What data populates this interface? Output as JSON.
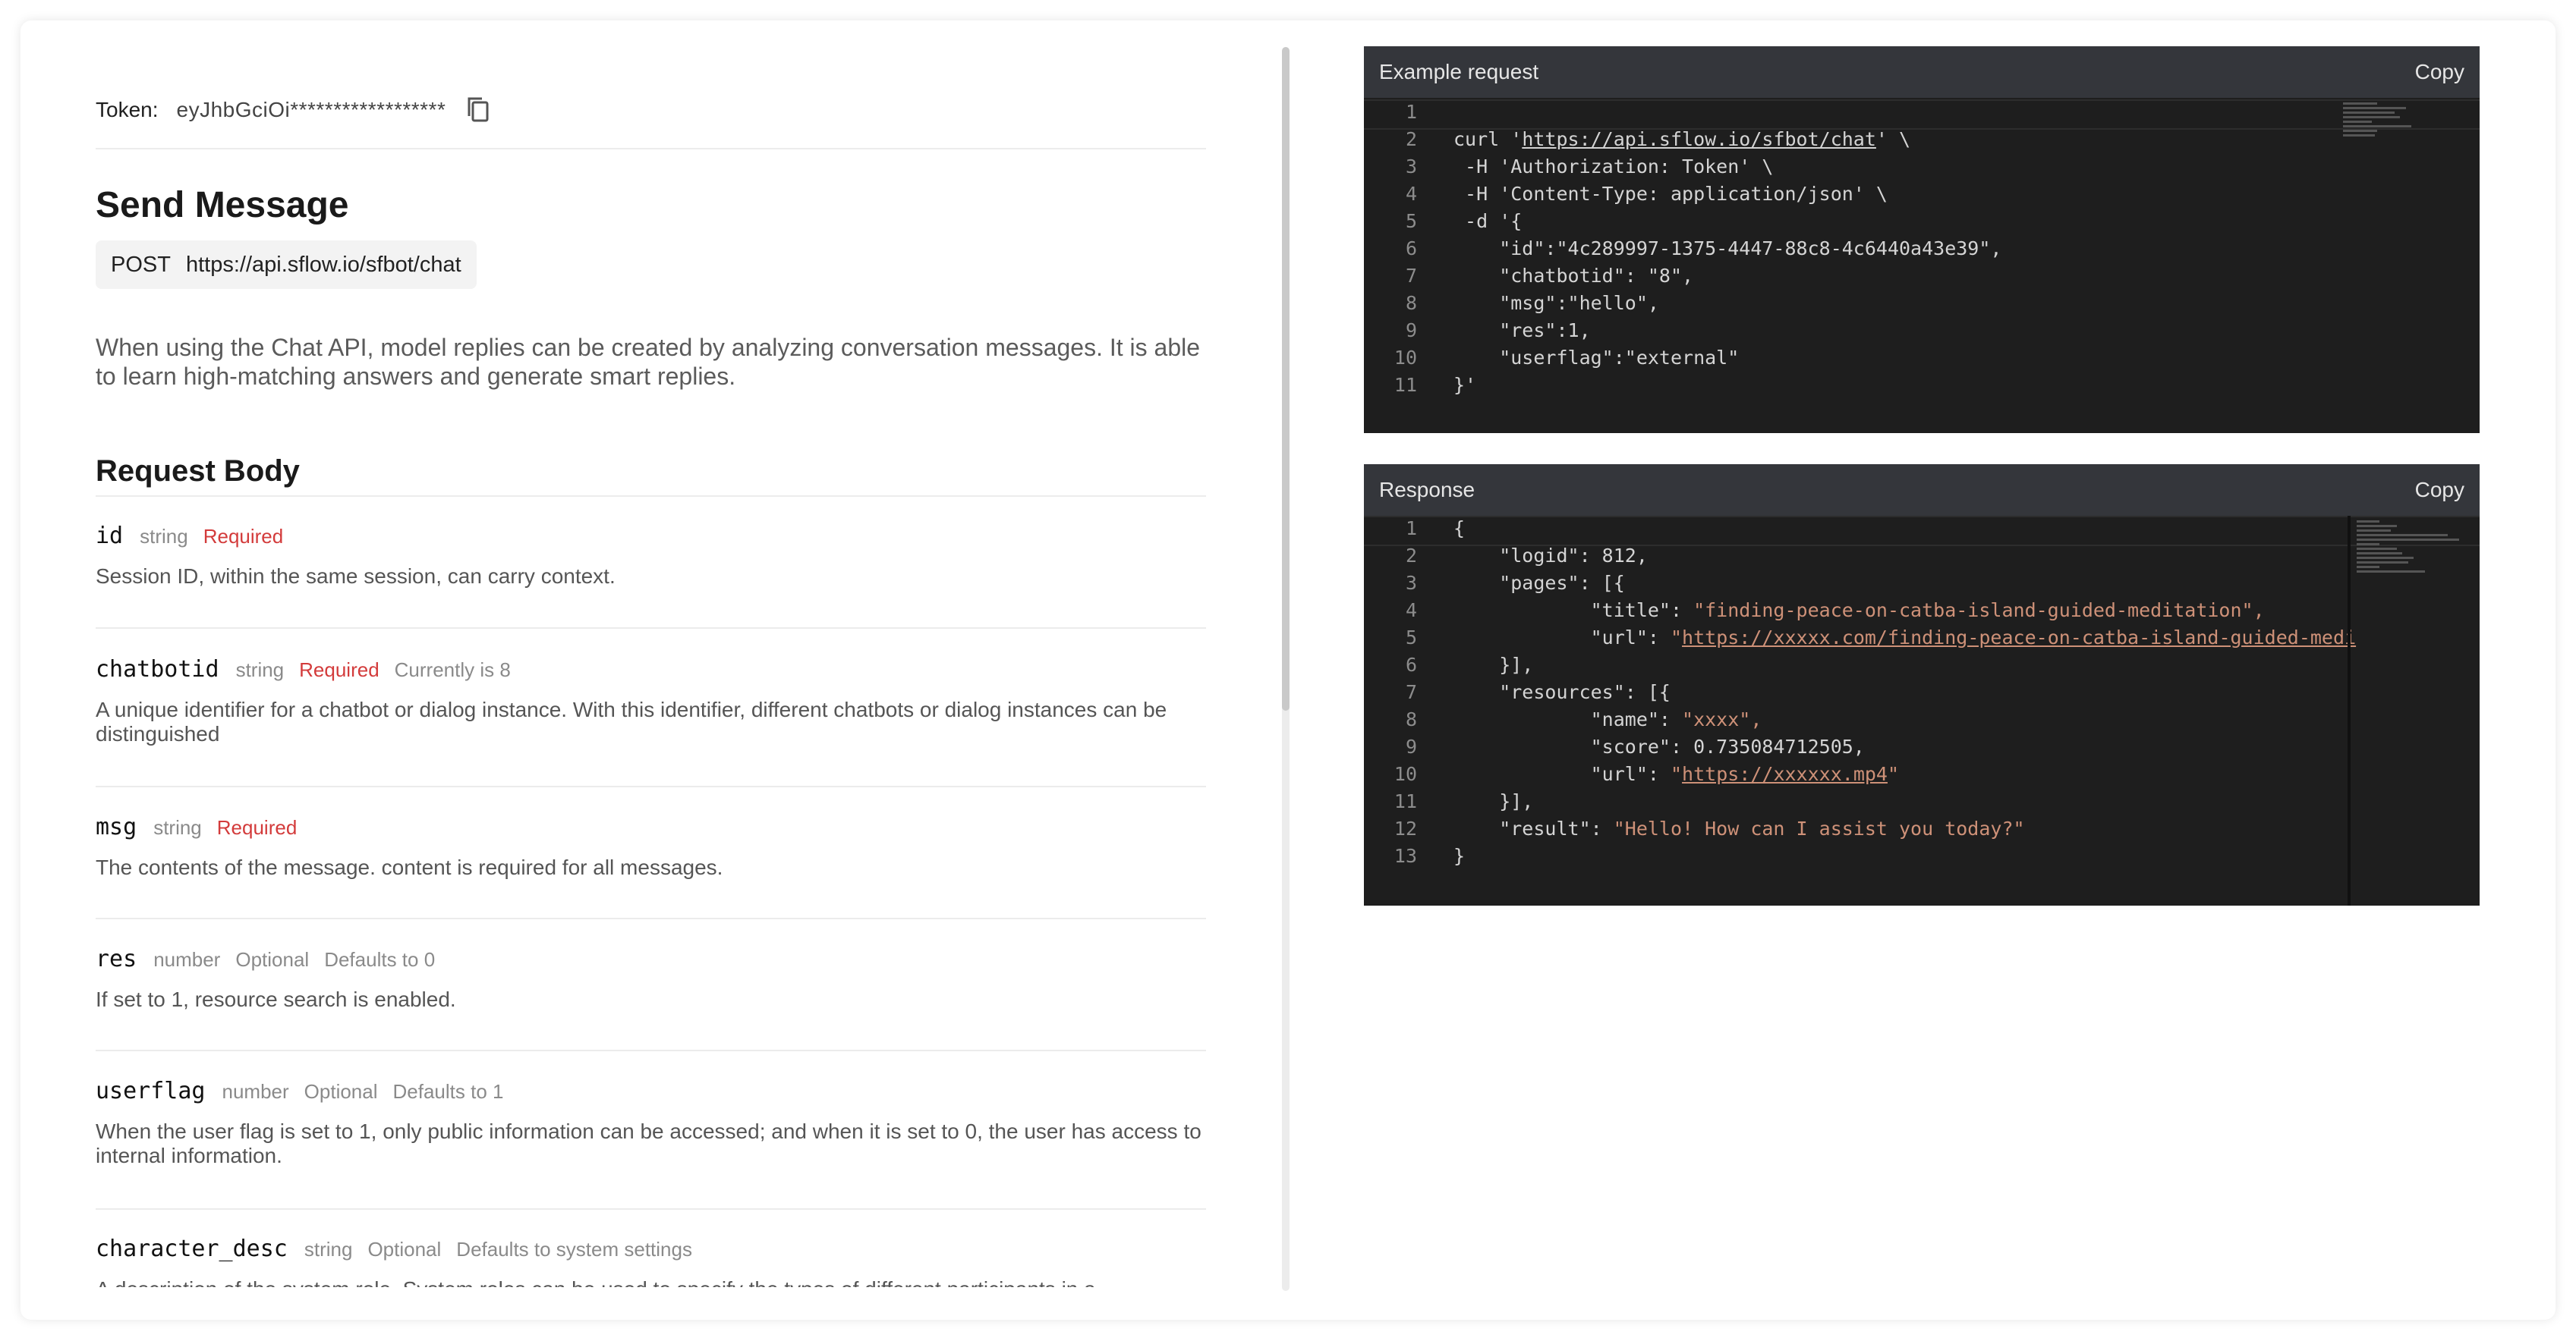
{
  "token": {
    "label": "Token:",
    "value": "eyJhbGciOi******************"
  },
  "page_title": "Send Message",
  "endpoint": {
    "method": "POST",
    "url": "https://api.sflow.io/sfbot/chat"
  },
  "description": "When using the Chat API, model replies can be created by analyzing conversation messages. It is able to learn high-matching answers and generate smart replies.",
  "request_body": {
    "title": "Request Body",
    "params": [
      {
        "name": "id",
        "type": "string",
        "required": "Required",
        "default": "",
        "desc": "Session ID, within the same session, can carry context."
      },
      {
        "name": "chatbotid",
        "type": "string",
        "required": "Required",
        "default": "Currently is 8",
        "desc": "A unique identifier for a chatbot or dialog instance. With this identifier, different chatbots or dialog instances can be distinguished"
      },
      {
        "name": "msg",
        "type": "string",
        "required": "Required",
        "default": "",
        "desc": "The contents of the message. content is required for all messages."
      },
      {
        "name": "res",
        "type": "number",
        "optional": "Optional",
        "default": "Defaults to 0",
        "desc": "If set to 1, resource search is enabled."
      },
      {
        "name": "userflag",
        "type": "number",
        "optional": "Optional",
        "default": "Defaults to 1",
        "desc": "When the user flag is set to 1, only public information can be accessed; and when it is set to 0, the user has access to internal information."
      },
      {
        "name": "character_desc",
        "type": "string",
        "optional": "Optional",
        "default": "Defaults to system settings",
        "desc": "A description of the system role. System roles can be used to specify the types of different participants in a"
      }
    ]
  },
  "example_request": {
    "title": "Example request",
    "copy_label": "Copy",
    "lines": [
      "",
      "curl 'https://api.sflow.io/sfbot/chat' \\",
      " -H 'Authorization: Token' \\",
      " -H 'Content-Type: application/json' \\",
      " -d '{",
      "    \"id\":\"4c289997-1375-4447-88c8-4c6440a43e39\",",
      "    \"chatbotid\": \"8\",",
      "    \"msg\":\"hello\",",
      "    \"res\":1,",
      "    \"userflag\":\"external\"",
      "}'"
    ]
  },
  "response": {
    "title": "Response",
    "copy_label": "Copy",
    "lines": [
      "{",
      "    \"logid\": 812,",
      "    \"pages\": [{",
      "            \"title\": \"finding-peace-on-catba-island-guided-meditation\",",
      "            \"url\": \"https://xxxxx.com/finding-peace-on-catba-island-guided-medi",
      "    }],",
      "    \"resources\": [{",
      "            \"name\": \"xxxx\",",
      "            \"score\": 0.735084712505,",
      "            \"url\": \"https://xxxxxx.mp4\"",
      "    }],",
      "    \"result\": \"Hello! How can I assist you today?\"",
      "}"
    ]
  },
  "colors": {
    "code_bg": "#1e1e1e",
    "code_header": "#34363b",
    "required": "#d33b3b",
    "string": "#ce9178"
  }
}
